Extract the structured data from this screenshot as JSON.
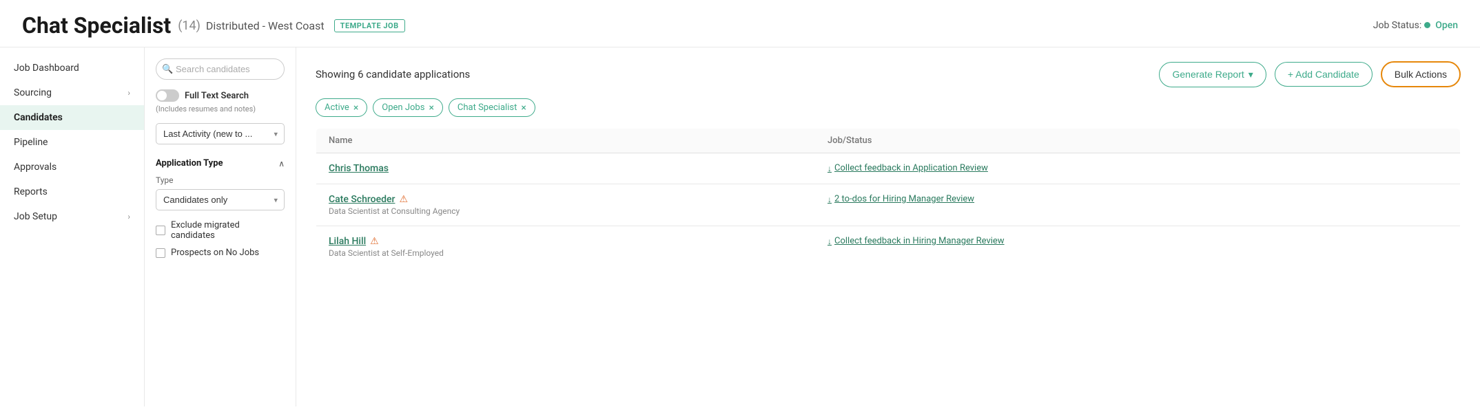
{
  "header": {
    "title": "Chat Specialist",
    "count": "(14)",
    "location": "Distributed - West Coast",
    "template_badge": "TEMPLATE JOB",
    "status_label": "Job Status:",
    "status_value": "Open"
  },
  "sidebar": {
    "items": [
      {
        "id": "job-dashboard",
        "label": "Job Dashboard",
        "has_chevron": false,
        "active": false
      },
      {
        "id": "sourcing",
        "label": "Sourcing",
        "has_chevron": true,
        "active": false
      },
      {
        "id": "candidates",
        "label": "Candidates",
        "has_chevron": false,
        "active": true
      },
      {
        "id": "pipeline",
        "label": "Pipeline",
        "has_chevron": false,
        "active": false
      },
      {
        "id": "approvals",
        "label": "Approvals",
        "has_chevron": false,
        "active": false
      },
      {
        "id": "reports",
        "label": "Reports",
        "has_chevron": false,
        "active": false
      },
      {
        "id": "job-setup",
        "label": "Job Setup",
        "has_chevron": true,
        "active": false
      }
    ]
  },
  "filter_panel": {
    "search_placeholder": "Search candidates",
    "full_text_search_label": "Full Text Search",
    "full_text_search_sub": "(Includes resumes and notes)",
    "sort_label": "Last Activity (new to ...",
    "sort_chevron": "▾",
    "application_type_section": "Application Type",
    "type_label": "Type",
    "type_value": "Candidates only",
    "checkboxes": [
      {
        "id": "exclude-migrated",
        "label": "Exclude migrated candidates"
      },
      {
        "id": "prospects-no-jobs",
        "label": "Prospects on No Jobs"
      }
    ]
  },
  "main": {
    "showing_text": "Showing 6 candidate applications",
    "buttons": {
      "generate_report": "Generate Report",
      "add_candidate": "+ Add Candidate",
      "bulk_actions": "Bulk Actions"
    },
    "chips": [
      {
        "id": "active",
        "label": "Active"
      },
      {
        "id": "open-jobs",
        "label": "Open Jobs"
      },
      {
        "id": "chat-specialist",
        "label": "Chat Specialist"
      }
    ],
    "table": {
      "columns": [
        "Name",
        "Job/Status"
      ],
      "rows": [
        {
          "name": "Chris Thomas",
          "has_warning": false,
          "sub": "",
          "job_status": "Collect feedback in Application Review",
          "job_status_arrow": "↓"
        },
        {
          "name": "Cate Schroeder",
          "has_warning": true,
          "sub": "Data Scientist at Consulting Agency",
          "job_status": "2 to-dos for Hiring Manager Review",
          "job_status_arrow": "↓"
        },
        {
          "name": "Lilah Hill",
          "has_warning": true,
          "sub": "Data Scientist at Self-Employed",
          "job_status": "Collect feedback in Hiring Manager Review",
          "job_status_arrow": "↓"
        }
      ]
    }
  }
}
